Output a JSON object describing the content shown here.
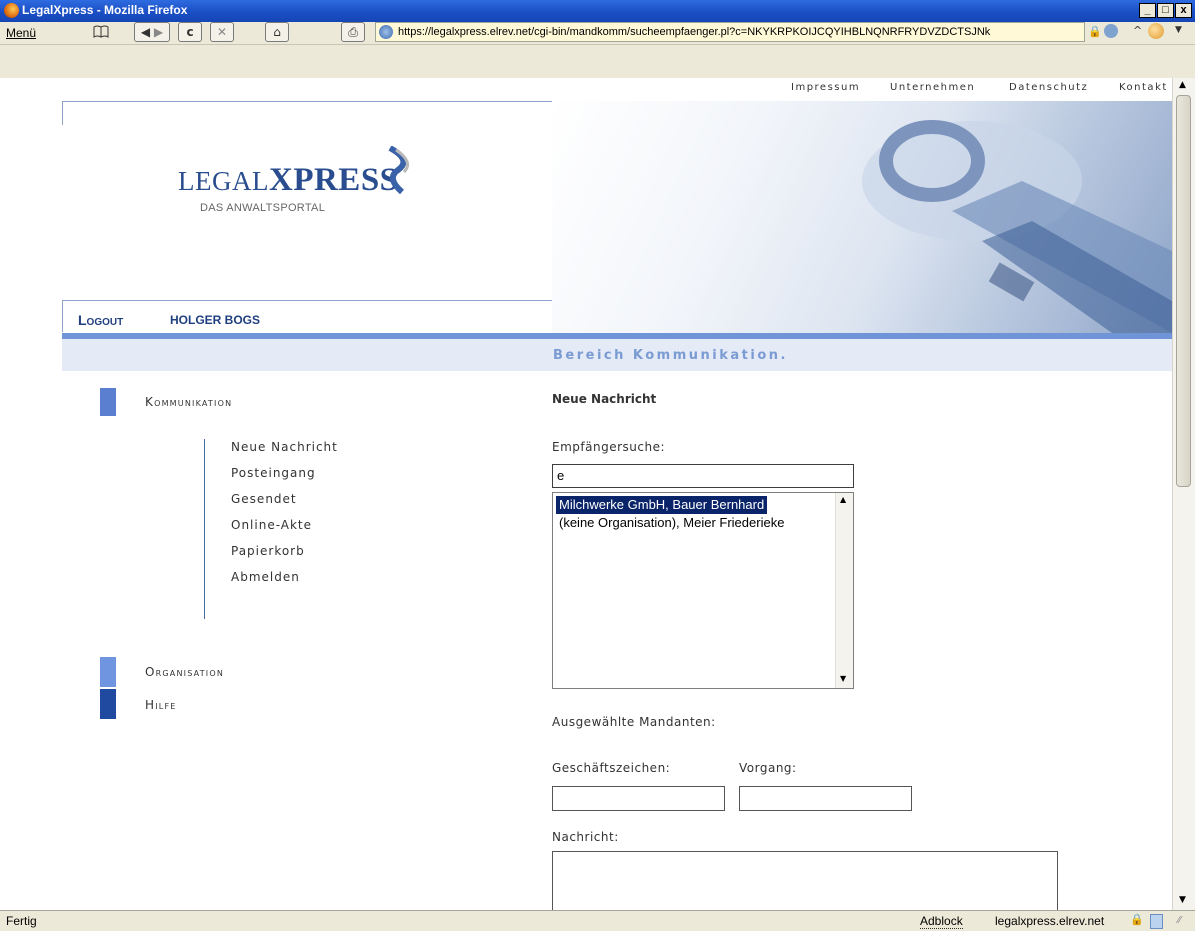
{
  "window": {
    "title": "LegalXpress - Mozilla Firefox",
    "controls": {
      "minimize": "_",
      "maximize": "□",
      "close": "x"
    }
  },
  "toolbar": {
    "menu_label": "Menü",
    "url": "https://legalxpress.elrev.net/cgi-bin/mandkomm/sucheempfaenger.pl?c=NKYKRPKOIJCQYIHBLNQNRFRYDVZDCTSJNk",
    "icons": [
      "bookmarks-icon",
      "back-icon",
      "forward-icon",
      "reload-icon",
      "stop-icon",
      "home-icon",
      "print-icon",
      "lock-icon",
      "go-icon",
      "chevron-up-icon",
      "search-engine-icon",
      "dropdown-icon"
    ]
  },
  "top_links": [
    "Impressum",
    "Unternehmen",
    "Datenschutz",
    "Kontakt"
  ],
  "logo": {
    "name_part1": "LEGAL",
    "name_part2": "XPRESS",
    "tagline": "DAS ANWALTSPORTAL"
  },
  "nav": {
    "logout": "Logout",
    "user": "HOLGER BOGS"
  },
  "section_banner": "Bereich Kommunikation.",
  "sidebar": {
    "sections": [
      {
        "label": "Kommunikation",
        "color": "#5b7fd0"
      },
      {
        "label": "Organisation",
        "color": "#6f95e0"
      },
      {
        "label": "Hilfe",
        "color": "#1f4aa0"
      }
    ],
    "submenu": [
      "Neue Nachricht",
      "Posteingang",
      "Gesendet",
      "Online-Akte",
      "Papierkorb",
      "Abmelden"
    ]
  },
  "form": {
    "heading": "Neue Nachricht",
    "recipient_search_label": "Empfängersuche:",
    "recipient_search_value": "e",
    "results": [
      {
        "text": "Milchwerke GmbH, Bauer Bernhard",
        "selected": true
      },
      {
        "text": "(keine Organisation), Meier Friederieke",
        "selected": false
      }
    ],
    "selected_clients_label": "Ausgewählte Mandanten:",
    "reference_label": "Geschäftszeichen:",
    "reference_value": "",
    "process_label": "Vorgang:",
    "process_value": "",
    "message_label": "Nachricht:",
    "message_value": ""
  },
  "statusbar": {
    "status": "Fertig",
    "adblock": "Adblock",
    "domain": "legalxpress.elrev.net"
  },
  "colors": {
    "titlebar": "#1a4fc5",
    "accent_blue": "#6f95d8",
    "nav_text": "#1f3f7f",
    "banner_text": "#7b9bd3",
    "selection": "#0a246a"
  }
}
